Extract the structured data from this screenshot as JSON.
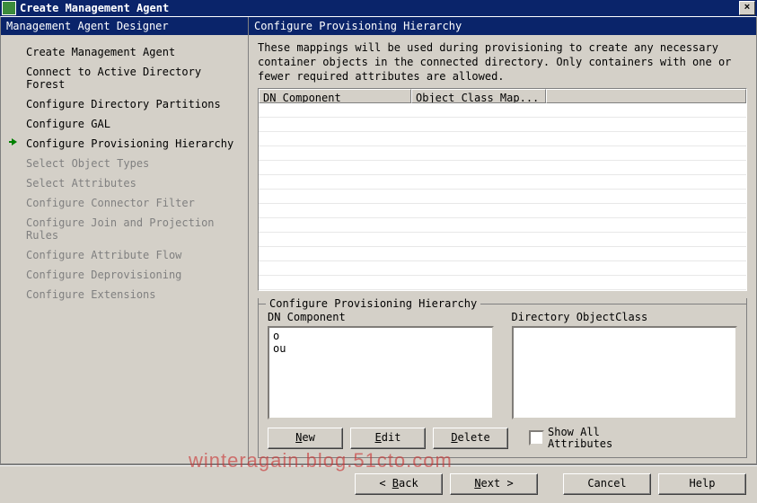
{
  "window": {
    "title": "Create Management Agent"
  },
  "left": {
    "header": "Management Agent Designer",
    "steps": [
      {
        "label": "Create Management Agent",
        "state": "done"
      },
      {
        "label": "Connect to Active Directory Forest",
        "state": "done"
      },
      {
        "label": "Configure Directory Partitions",
        "state": "done"
      },
      {
        "label": "Configure GAL",
        "state": "done"
      },
      {
        "label": "Configure Provisioning Hierarchy",
        "state": "current"
      },
      {
        "label": "Select Object Types",
        "state": "disabled"
      },
      {
        "label": "Select Attributes",
        "state": "disabled"
      },
      {
        "label": "Configure Connector Filter",
        "state": "disabled"
      },
      {
        "label": "Configure Join and Projection Rules",
        "state": "disabled"
      },
      {
        "label": "Configure Attribute Flow",
        "state": "disabled"
      },
      {
        "label": "Configure Deprovisioning",
        "state": "disabled"
      },
      {
        "label": "Configure Extensions",
        "state": "disabled"
      }
    ]
  },
  "right": {
    "header": "Configure Provisioning Hierarchy",
    "description": "These mappings will be used during provisioning to create any necessary container objects in the connected directory.  Only containers with one or fewer required attributes are allowed.",
    "table": {
      "col1": "DN Component",
      "col2": "Object Class Map..."
    },
    "group": {
      "legend": "Configure Provisioning Hierarchy",
      "dn_label": "DN Component",
      "objclass_label": "Directory ObjectClass",
      "dn_items": [
        "o",
        "ou"
      ],
      "objclass_items": [],
      "new_btn": "New",
      "edit_btn": "Edit",
      "delete_btn": "Delete",
      "showall_label": "Show All\nAttributes"
    }
  },
  "footer": {
    "back": "< Back",
    "next": "Next >",
    "cancel": "Cancel",
    "help": "Help"
  },
  "watermark": "winteragain.blog.51cto.com"
}
